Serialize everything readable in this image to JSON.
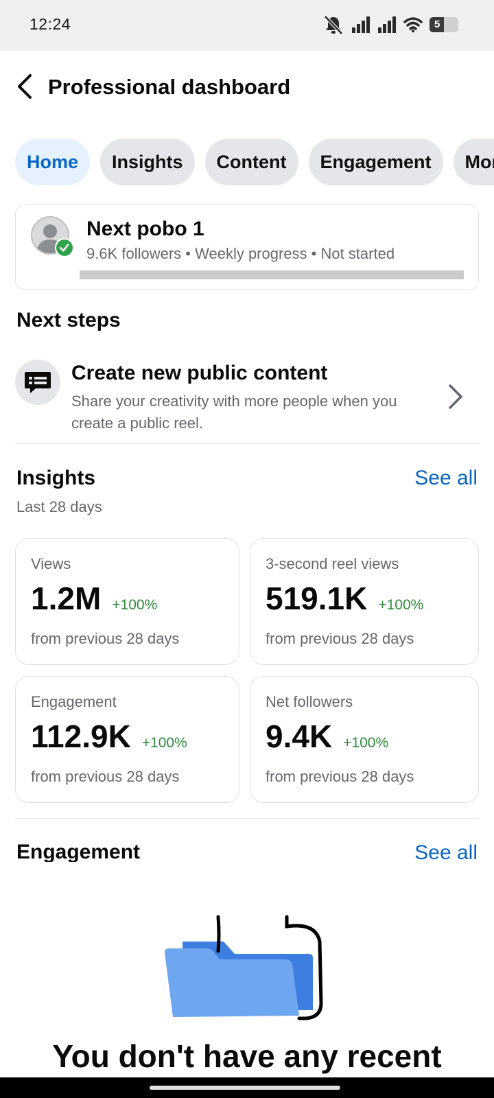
{
  "status_bar": {
    "time": "12:24",
    "battery_text": "5",
    "battery_level": 0.5,
    "icons": [
      "mute-icon",
      "signal-icon",
      "signal-icon",
      "wifi-icon",
      "battery-icon"
    ]
  },
  "header": {
    "title": "Professional dashboard",
    "back_icon": "chevron-left-icon"
  },
  "tabs": [
    {
      "label": "Home",
      "active": true
    },
    {
      "label": "Insights",
      "active": false
    },
    {
      "label": "Content",
      "active": false
    },
    {
      "label": "Engagement",
      "active": false
    },
    {
      "label": "Mon",
      "active": false
    }
  ],
  "profile": {
    "name": "Next pobo 1",
    "meta": "9.6K followers • Weekly progress • Not started",
    "progress": 0,
    "badge_icon": "check-icon"
  },
  "next_steps": {
    "title": "Next steps",
    "item": {
      "title": "Create new public content",
      "description": "Share your creativity with more people when you create a public reel.",
      "icon": "chat-icon"
    }
  },
  "insights": {
    "title": "Insights",
    "see_all": "See all",
    "subtitle": "Last 28 days",
    "metrics": [
      {
        "label": "Views",
        "value": "1.2M",
        "change": "+100%",
        "foot": "from previous 28 days"
      },
      {
        "label": "3-second reel views",
        "value": "519.1K",
        "change": "+100%",
        "foot": "from previous 28 days"
      },
      {
        "label": "Engagement",
        "value": "112.9K",
        "change": "+100%",
        "foot": "from previous 28 days"
      },
      {
        "label": "Net followers",
        "value": "9.4K",
        "change": "+100%",
        "foot": "from previous 28 days"
      }
    ]
  },
  "engagement": {
    "title": "Engagement",
    "see_all": "See all",
    "empty_text": "You don't have any recent"
  },
  "colors": {
    "accent": "#0a66c2",
    "positive": "#2e8b3a",
    "active_tab_bg": "#e5f1fd"
  }
}
